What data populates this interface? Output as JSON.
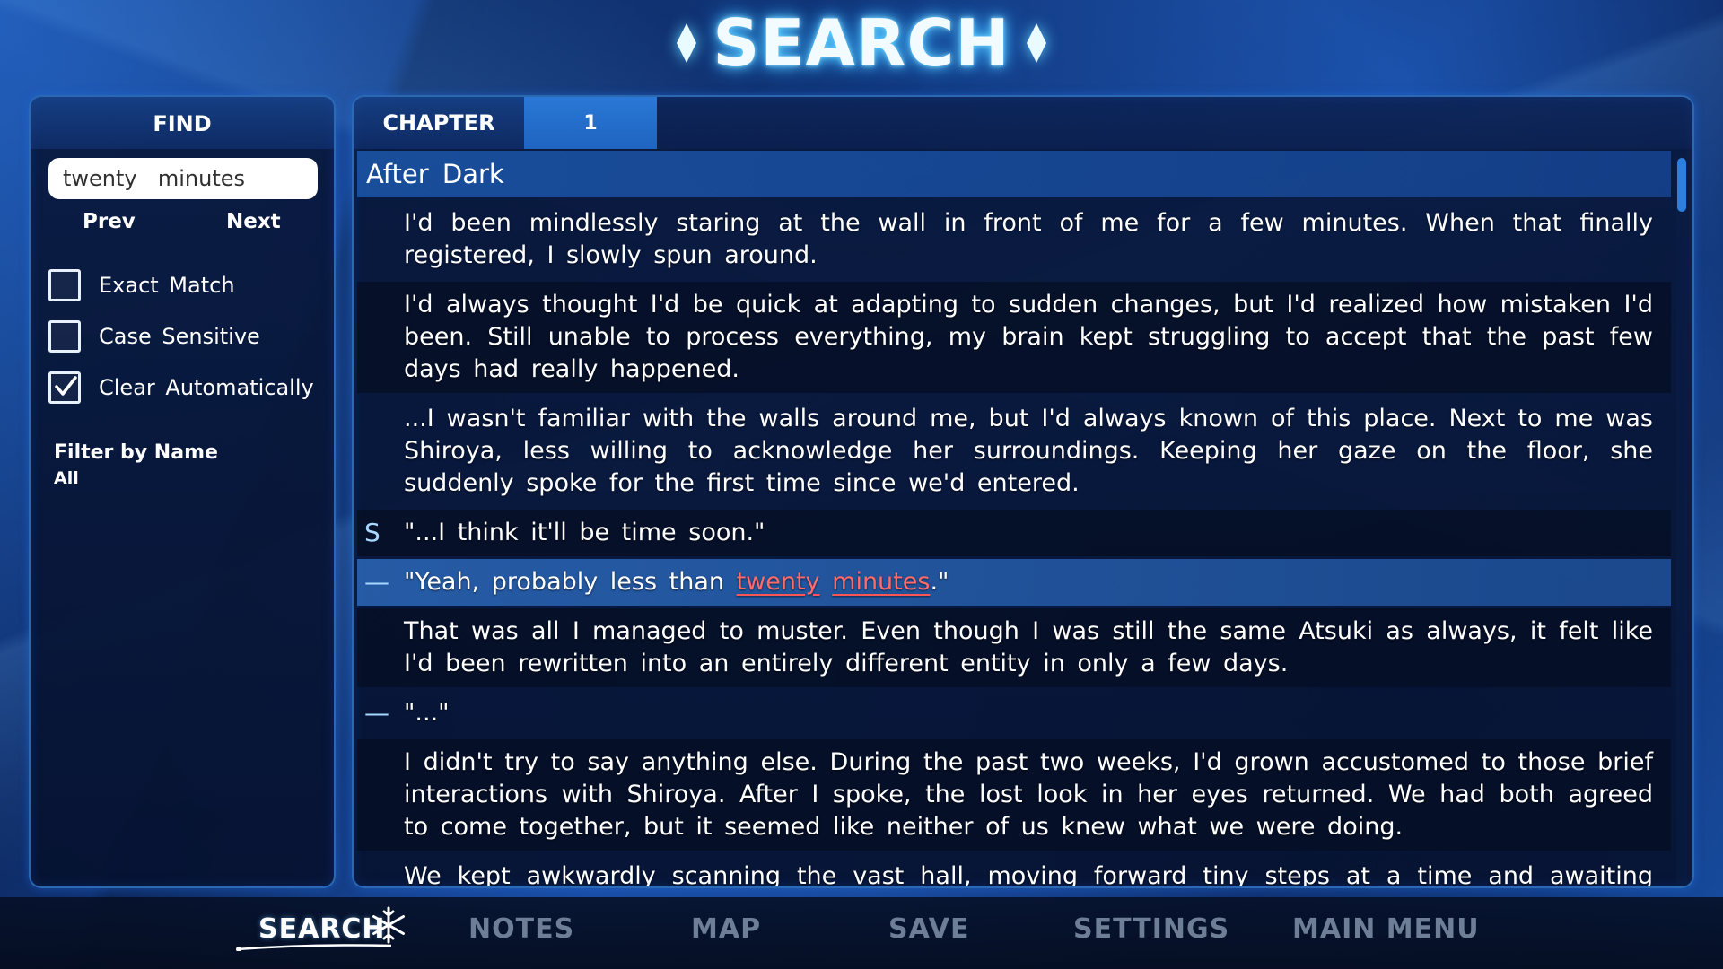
{
  "screen": {
    "title": "SEARCH"
  },
  "find_panel": {
    "header": "FIND",
    "search": {
      "value": "twenty  minutes",
      "placeholder": ""
    },
    "prev_label": "Prev",
    "next_label": "Next",
    "options": [
      {
        "label": "Exact  Match",
        "checked": false
      },
      {
        "label": "Case  Sensitive",
        "checked": false
      },
      {
        "label": "Clear  Automatically",
        "checked": true
      }
    ],
    "filter": {
      "title": "Filter by Name",
      "value": "All"
    }
  },
  "chapter": {
    "label": "CHAPTER",
    "number": "1"
  },
  "content": {
    "section_title": "After  Dark",
    "rows": [
      {
        "speaker": "",
        "text": "I'd been mindlessly staring at the wall in front of me for a few minutes. When that finally registered, I slowly spun around.",
        "style": "normal"
      },
      {
        "speaker": "",
        "text": "I'd always thought I'd be quick at adapting to sudden changes, but I'd realized how mistaken I'd been. Still unable to process everything, my brain kept struggling to accept that the past few days had really happened.",
        "style": "dark"
      },
      {
        "speaker": "",
        "text": "...I wasn't familiar with the walls around me, but I'd always known of this place. Next to me was Shiroya, less willing to acknowledge her surroundings. Keeping her gaze on the floor, she suddenly spoke for the first time since we'd entered.",
        "style": "normal"
      },
      {
        "speaker": "S",
        "text": "\"...I think it'll be time soon.\"",
        "style": "dark"
      },
      {
        "speaker": "—",
        "text_before": "\"Yeah, probably less than ",
        "match1": "twenty",
        "text_between": " ",
        "match2": "minutes",
        "text_after": ".\"",
        "style": "highlight"
      },
      {
        "speaker": "",
        "text": "That was all I managed to muster. Even though I was still the same Atsuki as always, it felt like I'd been rewritten into an entirely different entity in only a few days.",
        "style": "dark"
      },
      {
        "speaker": "—",
        "text": "\"...\"",
        "style": "normal"
      },
      {
        "speaker": "",
        "text": "I didn't try to say anything else. During the past two weeks, I'd grown accustomed to those brief interactions with Shiroya. After I spoke, the lost look in her eyes returned. We had both agreed to come together, but it seemed like neither of us knew what we were doing.",
        "style": "dark"
      },
      {
        "speaker": "",
        "text": "We kept awkwardly scanning the vast hall, moving forward tiny steps at a time and awaiting further",
        "style": "normal"
      }
    ]
  },
  "bottom_menu": {
    "items": [
      "SEARCH",
      "NOTES",
      "MAP",
      "SAVE",
      "SETTINGS",
      "MAIN MENU"
    ],
    "active": "SEARCH"
  },
  "colors": {
    "accent": "#2a78d6",
    "highlight_match": "#ff6b6b",
    "title_glow": "#5fd3ff",
    "inactive_menu": "#6e7e96"
  },
  "icons": [
    "diamond-icon",
    "checkmark-icon",
    "snowflake-icon"
  ]
}
